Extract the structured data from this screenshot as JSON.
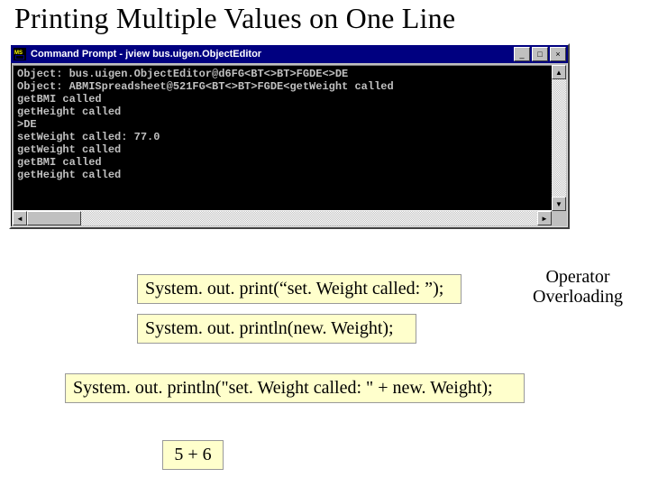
{
  "title": "Printing Multiple Values on One Line",
  "window": {
    "title": "Command Prompt - jview bus.uigen.ObjectEditor",
    "console_lines": [
      "Object: bus.uigen.ObjectEditor@d6FG<BT<>BT>FGDE<>DE",
      "Object: ABMISpreadsheet@521FG<BT<>BT>FGDE<getWeight called",
      "getBMI called",
      "getHeight called",
      ">DE",
      "setWeight called: 77.0",
      "getWeight called",
      "getBMI called",
      "getHeight called"
    ],
    "buttons": {
      "min": "_",
      "max": "□",
      "close": "×"
    },
    "arrows": {
      "up": "▲",
      "down": "▼",
      "left": "◄",
      "right": "►"
    }
  },
  "code": {
    "single1": "System. out. print(“set. Weight called: ”);",
    "single2": "System. out. println(new. Weight);",
    "combined": "System. out. println(\"set. Weight called: \" + new. Weight);",
    "expression": "5 + 6"
  },
  "annotation": {
    "line1": "Operator",
    "line2": "Overloading"
  }
}
